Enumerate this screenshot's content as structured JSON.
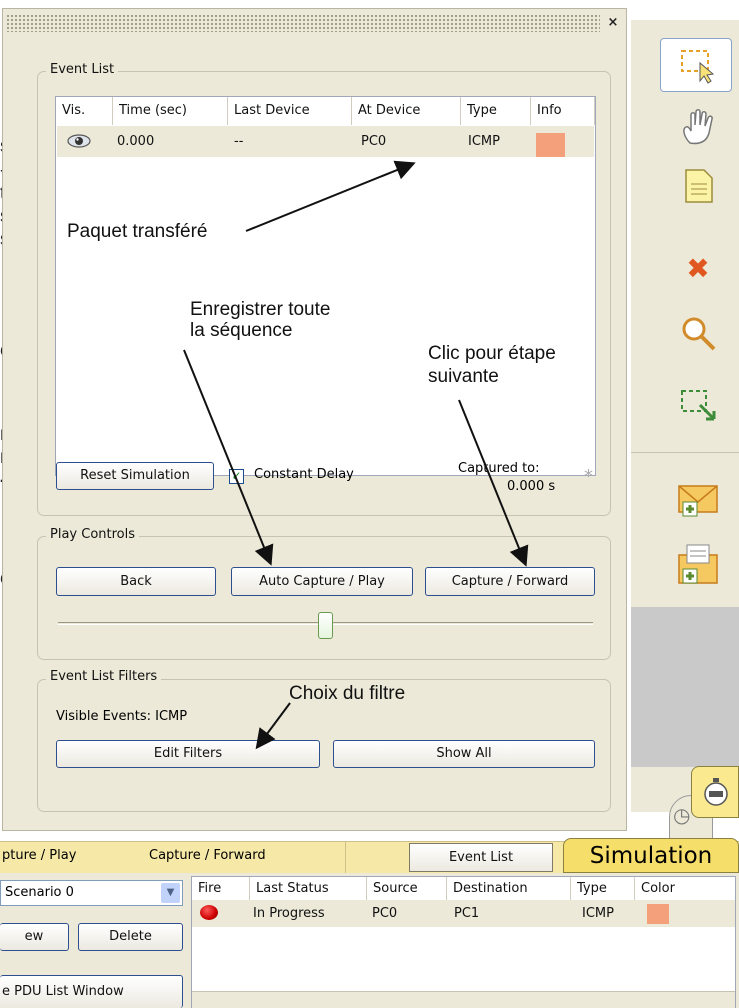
{
  "background_fragments": [
    "s",
    "-",
    "t",
    "s",
    "s",
    "er",
    "n",
    "n",
    "-",
    "e"
  ],
  "window": {
    "close_label": "×"
  },
  "event_list": {
    "title": "Event List",
    "columns": [
      "Vis.",
      "Time (sec)",
      "Last Device",
      "At Device",
      "Type",
      "Info"
    ],
    "rows": [
      {
        "vis_icon": "eye-icon",
        "time": "0.000",
        "last_device": "--",
        "at_device": "PC0",
        "type": "ICMP",
        "info_color": "#f4a07a"
      }
    ],
    "reset_button": "Reset Simulation",
    "constant_delay_label": "Constant Delay",
    "constant_delay_checked": true,
    "captured_to_label": "Captured to:",
    "captured_to_value": "0.000 s",
    "asterisk": "*"
  },
  "play_controls": {
    "title": "Play Controls",
    "back_button": "Back",
    "auto_capture_button": "Auto Capture / Play",
    "capture_forward_button": "Capture / Forward",
    "slider_position": 0.5
  },
  "filters": {
    "title": "Event List Filters",
    "visible_events": "Visible Events: ICMP",
    "edit_button": "Edit Filters",
    "show_all_button": "Show All"
  },
  "annotations": {
    "paquet": "Paquet transféré",
    "enregistrer_line1": "Enregistrer toute",
    "enregistrer_line2": "la séquence",
    "clic_line1": "Clic pour étape",
    "clic_line2": "suivante",
    "choix": "Choix du filtre"
  },
  "toolbar": {
    "icons": [
      "select-icon",
      "hand-icon",
      "note-icon",
      "delete-icon",
      "zoom-icon",
      "resize-select-icon",
      "add-simple-pdu-icon",
      "add-complex-pdu-icon"
    ]
  },
  "bottom_bar": {
    "tab_auto": "pture / Play",
    "tab_capture": "Capture / Forward",
    "event_list_button": "Event List",
    "mode_label": "Simulation"
  },
  "scenario": {
    "selected": "Scenario 0",
    "new_button": "ew",
    "delete_button": "Delete",
    "pdu_window_button": "e PDU List Window"
  },
  "pdu_list": {
    "columns": [
      "Fire",
      "Last Status",
      "Source",
      "Destination",
      "Type",
      "Color"
    ],
    "rows": [
      {
        "fire_color": "#cc0000",
        "status": "In Progress",
        "source": "PC0",
        "destination": "PC1",
        "type": "ICMP",
        "color": "#f4a07a"
      }
    ]
  },
  "colors": {
    "panel": "#ece9d8",
    "button_border": "#2e4f8f",
    "bottom_bar": "#f6e9a8",
    "mode_tab": "#f6de6b"
  }
}
